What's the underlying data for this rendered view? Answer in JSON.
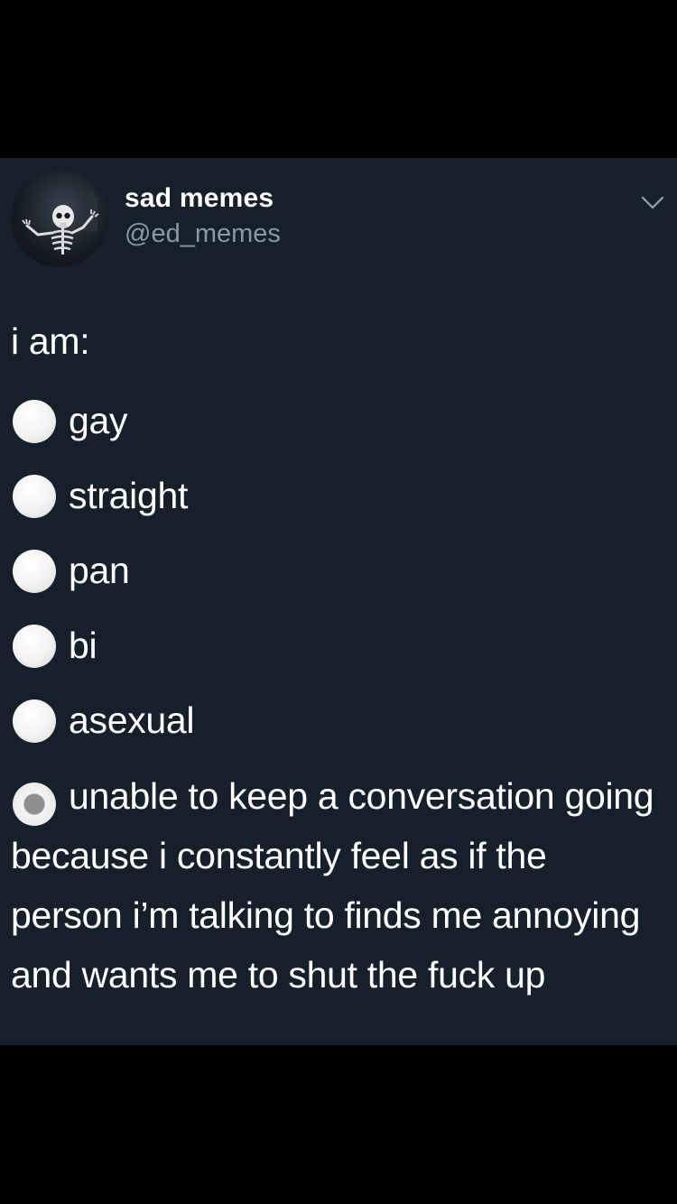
{
  "tweet": {
    "display_name": "sad memes",
    "handle": "@ed_memes",
    "intro": "i am:",
    "options": [
      {
        "label": "gay",
        "selected": false
      },
      {
        "label": "straight",
        "selected": false
      },
      {
        "label": "pan",
        "selected": false
      },
      {
        "label": "bi",
        "selected": false
      },
      {
        "label": "asexual",
        "selected": false
      },
      {
        "label": "unable to keep a conversation going because i constantly feel as if the person i’m talking to finds me annoying and wants me to shut the fuck up",
        "selected": true
      }
    ]
  },
  "icons": {
    "avatar": "skeleton-avatar",
    "menu": "chevron-down-icon",
    "radio": "radio-button"
  },
  "colors": {
    "card_background": "#15202b",
    "handle": "#8899a6",
    "text": "#ffffff",
    "outer_background": "#000000"
  }
}
